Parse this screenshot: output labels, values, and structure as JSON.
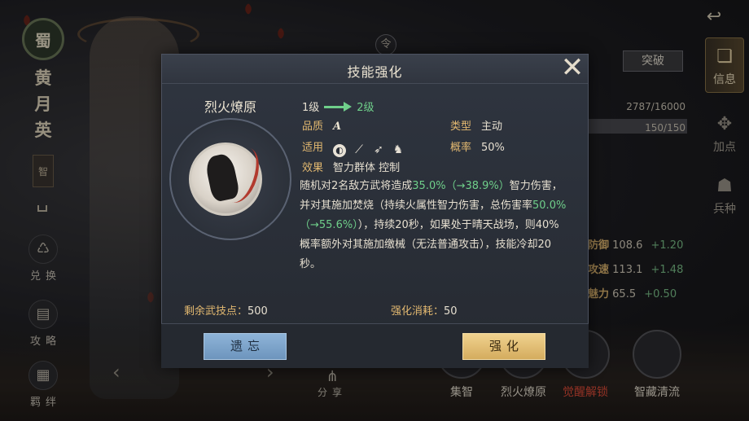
{
  "colors": {
    "accent_gold": "#e2b870",
    "highlight_green": "#6fcf8a",
    "button_blue": "#8eb4d8",
    "button_gold": "#f0d28f",
    "red_label": "#e24d3a"
  },
  "background": {
    "faction_badge": "蜀",
    "hero_name": "黄月英",
    "hero_attribute_tag": "智",
    "order_icon": "令",
    "breakthrough_label": "突破",
    "experience": "2787/16000",
    "hp": "150/150",
    "stats": [
      {
        "name": "防御",
        "value": "108.6",
        "increment": "+1.20"
      },
      {
        "name": "攻速",
        "value": "113.1",
        "increment": "+1.48"
      },
      {
        "name": "魅力",
        "value": "65.5",
        "increment": "+0.50"
      }
    ],
    "left_menu": [
      {
        "label": "兑换",
        "icon": "exchange-icon"
      },
      {
        "label": "攻略",
        "icon": "guide-icon"
      },
      {
        "label": "羁绊",
        "icon": "bond-icon"
      }
    ],
    "right_tabs": [
      {
        "label": "信息",
        "icon": "scroll-icon",
        "active": true
      },
      {
        "label": "加点",
        "icon": "points-icon",
        "active": false
      },
      {
        "label": "兵种",
        "icon": "troop-icon",
        "active": false
      }
    ],
    "skill_slots": [
      {
        "label": "集智"
      },
      {
        "label": "烈火燎原"
      },
      {
        "label": "觉醒解锁"
      },
      {
        "label": "智藏清流"
      }
    ],
    "share_label": "分享"
  },
  "modal": {
    "title": "技能强化",
    "close_icon": "crossed-swords-close-icon",
    "skill_name": "烈火燎原",
    "level_from": "1级",
    "level_to": "2级",
    "quality_key": "品质",
    "quality_value": "A",
    "type_key": "类型",
    "type_value": "主动",
    "applicable_key": "适用",
    "applicable_weapons": [
      "shield-icon",
      "bow-icon",
      "spear-icon",
      "horse-icon"
    ],
    "chance_key": "概率",
    "chance_value": "50%",
    "effect_key": "效果",
    "effect_value": "智力群体 控制",
    "description": {
      "p1": "随机对2名敌方武将造成",
      "h1": "35.0%（→38.9%）",
      "p2": "智力伤害，并对其施加焚烧（持续火属性智力伤害，总伤害率",
      "h2": "50.0%（→55.6%）",
      "p3": "），持续20秒，如果处于晴天战场，则40%概率额外对其施加缴械（无法普通攻击），技能冷却20秒。"
    },
    "remaining_points_label": "剩余武技点：",
    "remaining_points_value": "500",
    "cost_label": "强化消耗：",
    "cost_value": "50",
    "forget_button": "遗忘",
    "enhance_button": "强化"
  }
}
